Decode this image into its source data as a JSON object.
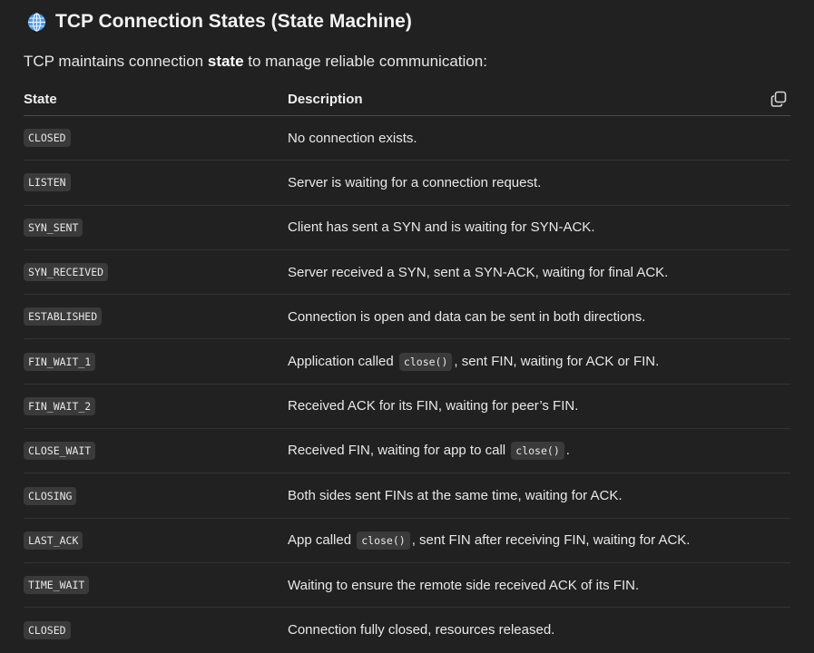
{
  "heading": {
    "icon": "globe-icon",
    "title": "TCP Connection States (State Machine)"
  },
  "intro": {
    "before": "TCP maintains connection ",
    "bold": "state",
    "after": " to manage reliable communication:"
  },
  "table": {
    "headers": {
      "state": "State",
      "description": "Description"
    },
    "copy_icon": "copy-icon",
    "rows": [
      {
        "state": "CLOSED",
        "desc": [
          {
            "t": "No connection exists."
          }
        ]
      },
      {
        "state": "LISTEN",
        "desc": [
          {
            "t": "Server is waiting for a connection request."
          }
        ]
      },
      {
        "state": "SYN_SENT",
        "desc": [
          {
            "t": "Client has sent a SYN and is waiting for SYN-ACK."
          }
        ]
      },
      {
        "state": "SYN_RECEIVED",
        "desc": [
          {
            "t": "Server received a SYN, sent a SYN-ACK, waiting for final ACK."
          }
        ]
      },
      {
        "state": "ESTABLISHED",
        "desc": [
          {
            "t": "Connection is open and data can be sent in both directions."
          }
        ]
      },
      {
        "state": "FIN_WAIT_1",
        "desc": [
          {
            "t": "Application called "
          },
          {
            "c": "close()"
          },
          {
            "t": ", sent FIN, waiting for ACK or FIN."
          }
        ]
      },
      {
        "state": "FIN_WAIT_2",
        "desc": [
          {
            "t": "Received ACK for its FIN, waiting for peer’s FIN."
          }
        ]
      },
      {
        "state": "CLOSE_WAIT",
        "desc": [
          {
            "t": "Received FIN, waiting for app to call "
          },
          {
            "c": "close()"
          },
          {
            "t": "."
          }
        ]
      },
      {
        "state": "CLOSING",
        "desc": [
          {
            "t": "Both sides sent FINs at the same time, waiting for ACK."
          }
        ]
      },
      {
        "state": "LAST_ACK",
        "desc": [
          {
            "t": "App called "
          },
          {
            "c": "close()"
          },
          {
            "t": ", sent FIN after receiving FIN, waiting for ACK."
          }
        ]
      },
      {
        "state": "TIME_WAIT",
        "desc": [
          {
            "t": "Waiting to ensure the remote side received ACK of its FIN."
          }
        ]
      },
      {
        "state": "CLOSED",
        "desc": [
          {
            "t": "Connection fully closed, resources released."
          }
        ]
      }
    ]
  }
}
